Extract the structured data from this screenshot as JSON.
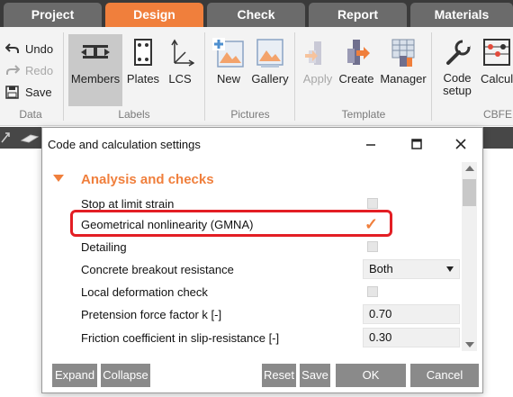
{
  "tabs": [
    {
      "label": "Project"
    },
    {
      "label": "Design"
    },
    {
      "label": "Check"
    },
    {
      "label": "Report"
    },
    {
      "label": "Materials"
    }
  ],
  "active_tab": "Design",
  "ribbon": {
    "data_group": {
      "undo": "Undo",
      "redo": "Redo",
      "save": "Save",
      "label": "Data"
    },
    "labels_group": {
      "members": "Members",
      "plates": "Plates",
      "lcs": "LCS",
      "label": "Labels"
    },
    "pictures_group": {
      "new": "New",
      "gallery": "Gallery",
      "label": "Pictures"
    },
    "template_group": {
      "apply": "Apply",
      "create": "Create",
      "manager": "Manager",
      "label": "Template"
    },
    "cbfem_group": {
      "code_setup_line1": "Code",
      "code_setup_line2": "setup",
      "calcul": "Calcul",
      "label": "CBFE"
    }
  },
  "dialog": {
    "title": "Code and calculation settings",
    "section_title": "Analysis and checks",
    "rows": {
      "stop_limit_strain": "Stop at limit strain",
      "gmna": "Geometrical nonlinearity (GMNA)",
      "detailing": "Detailing",
      "concrete_breakout": "Concrete breakout resistance",
      "local_deformation": "Local deformation check",
      "pretension": "Pretension force factor k [-]",
      "friction": "Friction coefficient in slip-resistance [-]"
    },
    "values": {
      "gmna_checked": "✓",
      "concrete_breakout": "Both",
      "pretension": "0.70",
      "friction": "0.30"
    },
    "buttons": {
      "expand": "Expand",
      "collapse": "Collapse",
      "reset": "Reset",
      "save": "Save",
      "ok": "OK",
      "cancel": "Cancel"
    }
  },
  "colors": {
    "accent": "#f07f3c",
    "highlight": "#e31e24"
  }
}
